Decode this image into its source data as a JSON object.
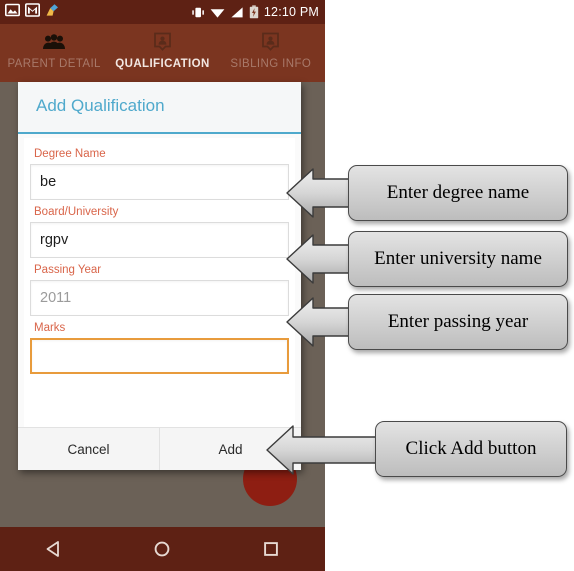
{
  "statusbar": {
    "time": "12:10 PM",
    "left_icons": [
      "screenshot-icon",
      "gmail-icon",
      "cleaner-broom-icon"
    ],
    "right_icons": [
      "vibrate-icon",
      "wifi-icon",
      "signal-icon",
      "battery-charging-icon"
    ]
  },
  "tabs": [
    {
      "label": "PARENT DETAIL",
      "icon": "group-people-icon",
      "active": false
    },
    {
      "label": "QUALIFICATION",
      "icon": "certificate-icon",
      "active": true
    },
    {
      "label": "SIBLING INFO",
      "icon": "certificate-icon",
      "active": false
    }
  ],
  "dialog": {
    "title": "Add Qualification",
    "fields": [
      {
        "label": "Degree Name",
        "value": "be",
        "is_placeholder": false,
        "focused": false
      },
      {
        "label": "Board/University",
        "value": "rgpv",
        "is_placeholder": false,
        "focused": false
      },
      {
        "label": "Passing Year",
        "value": "2011",
        "is_placeholder": true,
        "focused": false
      },
      {
        "label": "Marks",
        "value": "",
        "is_placeholder": false,
        "focused": true
      }
    ],
    "cancel_label": "Cancel",
    "add_label": "Add"
  },
  "navbar": {
    "back": "back-triangle-icon",
    "home": "home-circle-icon",
    "recents": "recents-square-icon"
  },
  "callouts": [
    {
      "text": "Enter degree name"
    },
    {
      "text": "Enter university name"
    },
    {
      "text": "Enter passing year"
    },
    {
      "text": "Click Add button"
    }
  ],
  "colors": {
    "status_bar": "#5e2114",
    "tab_bar": "#7b3520",
    "accent_title": "#4fa9cc",
    "label": "#d9654a",
    "focus_border": "#e89b3c",
    "fab": "#8e1e12",
    "scrim": "#6b6157"
  }
}
